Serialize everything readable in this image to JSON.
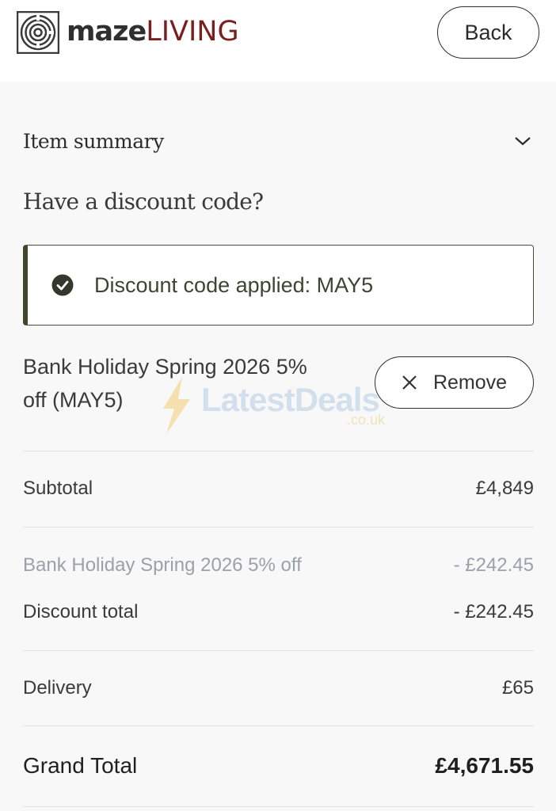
{
  "header": {
    "logo_maze": "maze",
    "logo_living": "LIVING",
    "back_label": "Back"
  },
  "summary": {
    "item_summary_label": "Item summary",
    "discount_heading": "Have a discount code?"
  },
  "discount": {
    "applied_message": "Discount code applied: MAY5",
    "promo_line1": "Bank Holiday Spring 2026 5%",
    "promo_line2": "off (MAY5)",
    "remove_label": "Remove"
  },
  "watermark": {
    "brand": "LatestDeals",
    "suffix": ".co.uk"
  },
  "totals": {
    "subtotal_label": "Subtotal",
    "subtotal_value": "£4,849",
    "discount_line_label": "Bank Holiday Spring 2026 5% off",
    "discount_line_value": "- £242.45",
    "discount_total_label": "Discount total",
    "discount_total_value": "- £242.45",
    "delivery_label": "Delivery",
    "delivery_value": "£65",
    "grand_total_label": "Grand Total",
    "grand_total_value": "£4,671.55"
  },
  "colors": {
    "brand_dark": "#2f2f2f",
    "brand_red": "#7a1f1f",
    "success_green": "#3d4a2a"
  }
}
